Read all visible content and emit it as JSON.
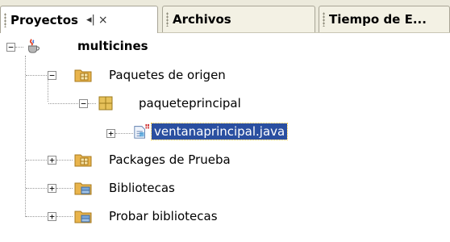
{
  "tabs": [
    {
      "label": "Proyectos",
      "active": true,
      "controls": "◀▶",
      "close": "×"
    },
    {
      "label": "Archivos",
      "active": false
    },
    {
      "label": "Tiempo de E...",
      "active": false
    }
  ],
  "tree": {
    "project": "multicines",
    "source_packages": "Paquetes de origen",
    "package": "paqueteprincipal",
    "file": "ventanaprincipal.java",
    "test_packages": "Packages de Prueba",
    "libraries": "Bibliotecas",
    "test_libraries": "Probar bibliotecas"
  },
  "colors": {
    "selection": "#2a4fa0",
    "folder": "#e9b44c",
    "package": "#d8b04a"
  }
}
